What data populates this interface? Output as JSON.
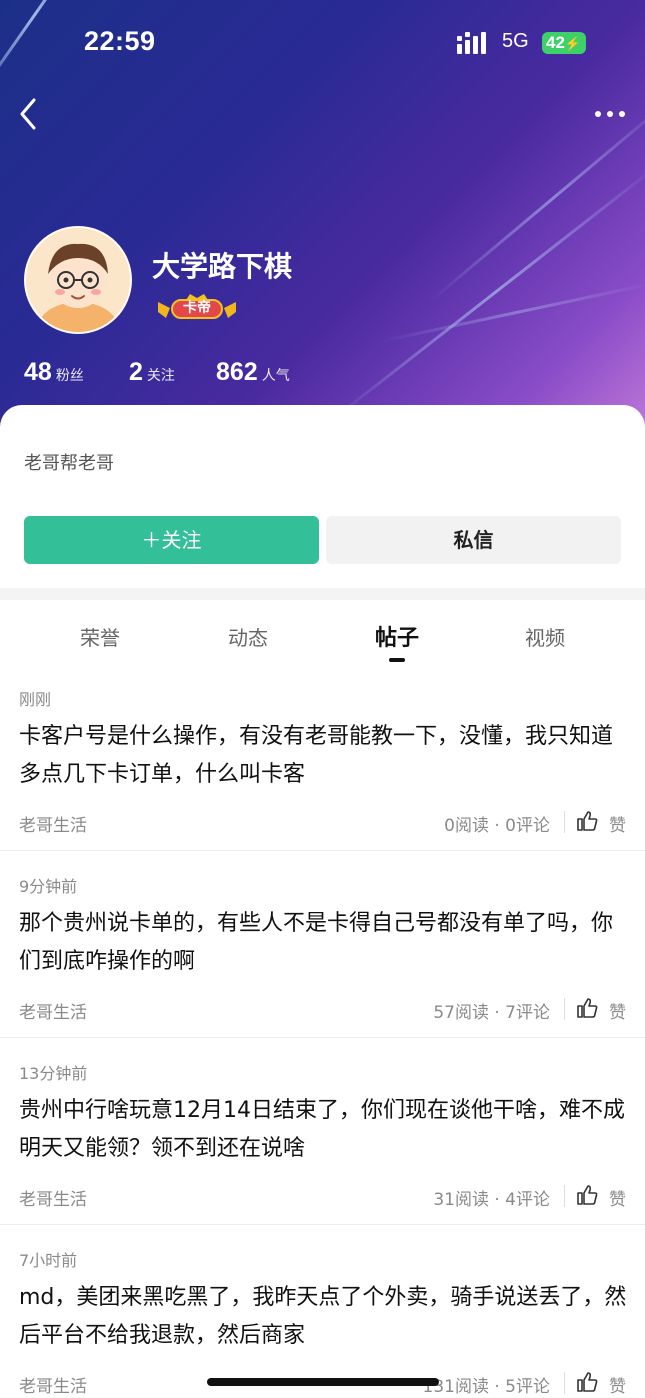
{
  "status_bar": {
    "time": "22:59",
    "network": "5G",
    "battery": "42"
  },
  "profile": {
    "username": "大学路下棋",
    "badge": "卡帝",
    "stats": [
      {
        "num": "48",
        "label": "粉丝"
      },
      {
        "num": "2",
        "label": "关注"
      },
      {
        "num": "862",
        "label": "人气"
      }
    ],
    "bio": "老哥帮老哥",
    "follow_label": "＋关注",
    "message_label": "私信"
  },
  "tabs": [
    {
      "label": "荣誉"
    },
    {
      "label": "动态"
    },
    {
      "label": "帖子"
    },
    {
      "label": "视频"
    }
  ],
  "active_tab": "帖子",
  "posts": [
    {
      "time": "刚刚",
      "content": "卡客户号是什么操作，有没有老哥能教一下，没懂，我只知道多点几下卡订单，什么叫卡客",
      "category": "老哥生活",
      "meta": "0阅读 · 0评论",
      "like": "赞"
    },
    {
      "time": "9分钟前",
      "content": "那个贵州说卡单的，有些人不是卡得自己号都没有单了吗，你们到底咋操作的啊",
      "category": "老哥生活",
      "meta": "57阅读 · 7评论",
      "like": "赞"
    },
    {
      "time": "13分钟前",
      "content": "贵州中行啥玩意12月14日结束了，你们现在谈他干啥，难不成明天又能领？领不到还在说啥",
      "category": "老哥生活",
      "meta": "31阅读 · 4评论",
      "like": "赞"
    },
    {
      "time": "7小时前",
      "content": "md，美团来黑吃黑了，我昨天点了个外卖，骑手说送丢了，然后平台不给我退款，然后商家",
      "category": "老哥生活",
      "meta": "131阅读 · 5评论",
      "like": "赞"
    }
  ],
  "colors": {
    "accent": "#33bf97",
    "header_start": "#1c2f88",
    "header_end": "#c07ad8"
  }
}
